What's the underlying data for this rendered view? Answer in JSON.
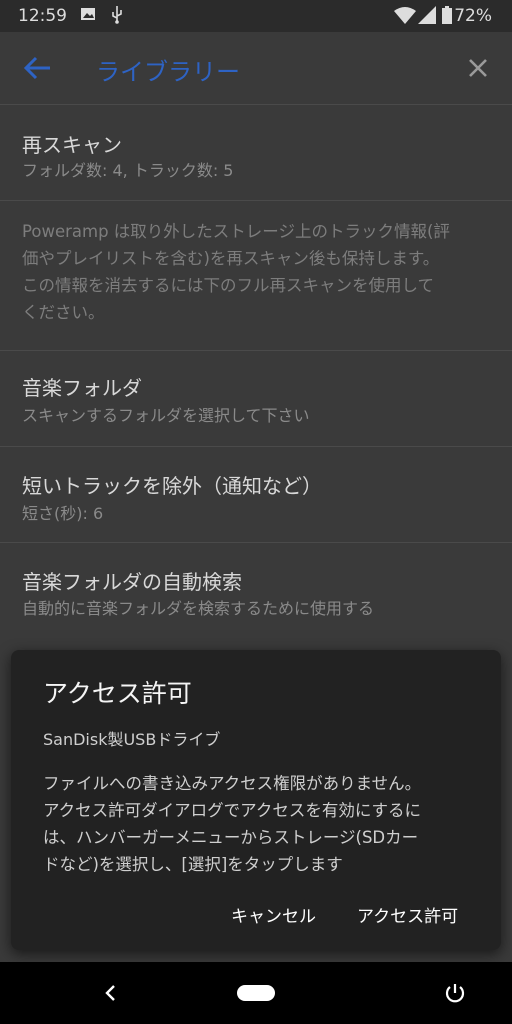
{
  "status_bar": {
    "time": "12:59",
    "battery_pct": "72%"
  },
  "toolbar": {
    "title": "ライブラリー"
  },
  "settings": [
    {
      "title": "再スキャン",
      "summary": "フォルダ数: 4, トラック数: 5"
    },
    {
      "title": "音楽フォルダ",
      "summary": "スキャンするフォルダを選択して下さい"
    },
    {
      "title": "短いトラックを除外（通知など）",
      "summary": "短さ(秒): 6"
    },
    {
      "title": "音楽フォルダの自動検索",
      "summary": "自動的に音楽フォルダを検索するために使用する"
    }
  ],
  "info": {
    "line1": "Poweramp は取り外したストレージ上のトラック情報(評",
    "line2": "価やプレイリストを含む)を再スキャン後も保持します。",
    "line3": "この情報を消去するには下のフル再スキャンを使用して",
    "line4": "ください。"
  },
  "dialog": {
    "title": "アクセス許可",
    "subtitle": "SanDisk製USBドライブ",
    "body_line1": "ファイルへの書き込みアクセス権限がありません。",
    "body_line2": "アクセス許可ダイアログでアクセスを有効にするに",
    "body_line3": "は、ハンバーガーメニューからストレージ(SDカー",
    "body_line4": "ドなど)を選択し、[選択]をタップします",
    "cancel_label": "キャンセル",
    "allow_label": "アクセス許可"
  },
  "colors": {
    "accent": "#2e63c4",
    "dialog_bg": "#222222",
    "scrim_bg": "#3a3a3a"
  },
  "icons": [
    "image-icon",
    "usb-icon",
    "wifi-icon",
    "signal-icon",
    "battery-icon",
    "back-arrow-icon",
    "close-icon",
    "nav-back-icon",
    "nav-home-icon",
    "power-icon"
  ]
}
